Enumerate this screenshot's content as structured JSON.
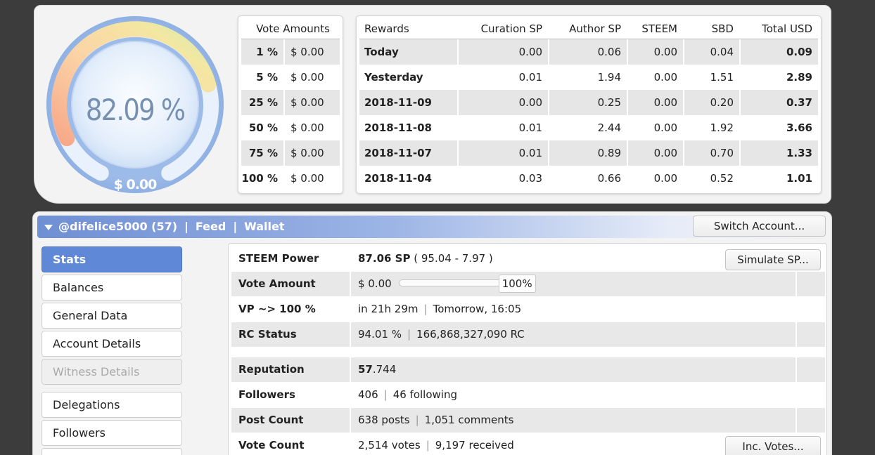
{
  "gauge": {
    "percent": "82.09 %",
    "usd": "$ 0.00",
    "level": 0.8209
  },
  "vote_amounts": {
    "header": "Vote Amounts",
    "rows": [
      {
        "pct": "1 %",
        "amount": "$ 0.00"
      },
      {
        "pct": "5 %",
        "amount": "$ 0.00"
      },
      {
        "pct": "25 %",
        "amount": "$ 0.00"
      },
      {
        "pct": "50 %",
        "amount": "$ 0.00"
      },
      {
        "pct": "75 %",
        "amount": "$ 0.00"
      },
      {
        "pct": "100 %",
        "amount": "$ 0.00"
      }
    ]
  },
  "rewards": {
    "headers": [
      "Rewards",
      "Curation SP",
      "Author SP",
      "STEEM",
      "SBD",
      "Total USD"
    ],
    "rows": [
      [
        "Today",
        "0.00",
        "0.06",
        "0.00",
        "0.04",
        "0.09"
      ],
      [
        "Yesterday",
        "0.01",
        "1.94",
        "0.00",
        "1.51",
        "2.89"
      ],
      [
        "2018-11-09",
        "0.00",
        "0.25",
        "0.00",
        "0.20",
        "0.37"
      ],
      [
        "2018-11-08",
        "0.01",
        "2.44",
        "0.00",
        "1.92",
        "3.66"
      ],
      [
        "2018-11-07",
        "0.01",
        "0.89",
        "0.00",
        "0.70",
        "1.33"
      ],
      [
        "2018-11-04",
        "0.03",
        "0.66",
        "0.00",
        "0.52",
        "1.01"
      ]
    ]
  },
  "account_bar": {
    "account": "@difelice5000 (57)",
    "separator": "|",
    "feed": "Feed",
    "wallet": "Wallet",
    "switch_button": "Switch Account..."
  },
  "nav": {
    "items": [
      "Stats",
      "Balances",
      "General Data",
      "Account Details",
      "Witness Details",
      "Delegations",
      "Followers"
    ]
  },
  "stats": {
    "steem_power": {
      "label": "STEEM Power",
      "value": "87.06 SP",
      "detail": "( 95.04 - 7.97 )",
      "button": "Simulate SP..."
    },
    "vote_amount": {
      "label": "Vote Amount",
      "value": "$ 0.00",
      "slider_value": "100%"
    },
    "vp": {
      "label": "VP ~> 100 %",
      "value": "in 21h 29m",
      "detail": "Tomorrow, 16:05"
    },
    "rc": {
      "label": "RC Status",
      "value": "94.01 %",
      "detail": "166,868,327,090 RC"
    },
    "reputation": {
      "label": "Reputation",
      "value_bold": "57",
      "value_rest": ".744"
    },
    "followers": {
      "label": "Followers",
      "value": "406",
      "detail": "46 following"
    },
    "posts": {
      "label": "Post Count",
      "value": "638 posts",
      "detail": "1,051 comments"
    },
    "votes": {
      "label": "Vote Count",
      "value": "2,514 votes",
      "detail": "9,197 received",
      "button": "Inc. Votes..."
    }
  }
}
